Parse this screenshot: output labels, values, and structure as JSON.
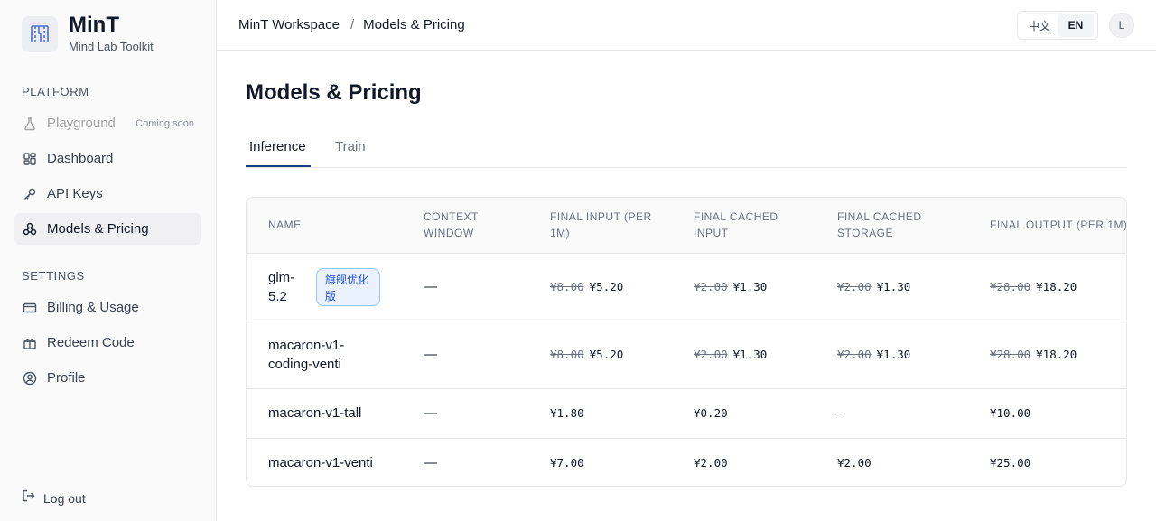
{
  "brand": {
    "title": "MinT",
    "subtitle": "Mind Lab Toolkit"
  },
  "sidebar": {
    "platform_label": "PLATFORM",
    "settings_label": "SETTINGS",
    "platform_items": [
      {
        "label": "Playground",
        "icon": "flask-icon",
        "badge": "Coming soon",
        "disabled": true
      },
      {
        "label": "Dashboard",
        "icon": "dashboard-icon"
      },
      {
        "label": "API Keys",
        "icon": "key-icon"
      },
      {
        "label": "Models & Pricing",
        "icon": "models-icon",
        "active": true
      }
    ],
    "settings_items": [
      {
        "label": "Billing & Usage",
        "icon": "credit-card-icon"
      },
      {
        "label": "Redeem Code",
        "icon": "gift-icon"
      },
      {
        "label": "Profile",
        "icon": "user-circle-icon"
      }
    ],
    "logout": "Log out"
  },
  "header": {
    "breadcrumb": [
      "MinT Workspace",
      "/",
      "Models & Pricing"
    ],
    "lang_zh": "中文",
    "lang_en": "EN",
    "avatar": "L"
  },
  "main": {
    "title": "Models & Pricing",
    "tabs": [
      "Inference",
      "Train"
    ],
    "table": {
      "headers": [
        "NAME",
        "CONTEXT WINDOW",
        "FINAL INPUT (PER 1M)",
        "FINAL CACHED INPUT",
        "FINAL CACHED STORAGE",
        "FINAL OUTPUT (PER 1M)"
      ],
      "rows": [
        {
          "name": "glm-5.2",
          "badge": "旗舰优化版",
          "context": "—",
          "input_old": "¥8.00",
          "input": "¥5.20",
          "cached_input_old": "¥2.00",
          "cached_input": "¥1.30",
          "cached_storage_old": "¥2.00",
          "cached_storage": "¥1.30",
          "output_old": "¥28.00",
          "output": "¥18.20"
        },
        {
          "name": "macaron-v1-coding-venti",
          "context": "—",
          "input_old": "¥8.00",
          "input": "¥5.20",
          "cached_input_old": "¥2.00",
          "cached_input": "¥1.30",
          "cached_storage_old": "¥2.00",
          "cached_storage": "¥1.30",
          "output_old": "¥28.00",
          "output": "¥18.20"
        },
        {
          "name": "macaron-v1-tall",
          "context": "—",
          "input": "¥1.80",
          "cached_input": "¥0.20",
          "cached_storage": "—",
          "output": "¥10.00"
        },
        {
          "name": "macaron-v1-venti",
          "context": "—",
          "input": "¥7.00",
          "cached_input": "¥2.00",
          "cached_storage": "¥2.00",
          "output": "¥25.00"
        }
      ]
    }
  },
  "colors": {
    "accent": "#1e3a8a",
    "badge_bg": "#eaf2ff",
    "badge_text": "#1d4ed8"
  }
}
